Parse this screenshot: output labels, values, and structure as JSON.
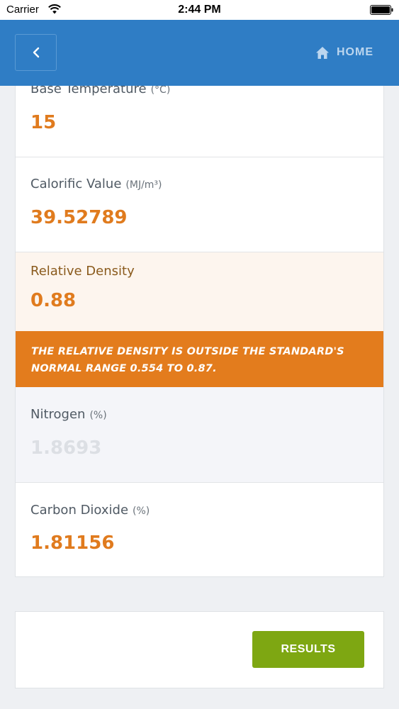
{
  "status_bar": {
    "carrier": "Carrier",
    "time": "2:44 PM"
  },
  "header": {
    "home_label": "HOME",
    "color": "#2f7dc5"
  },
  "fields": [
    {
      "label": "Base Temperature",
      "unit": "(°C)",
      "value": "15"
    },
    {
      "label": "Calorific Value",
      "unit": "(MJ/m³)",
      "value": "39.52789"
    },
    {
      "label": "Relative Density",
      "unit": "",
      "value": "0.88"
    },
    {
      "label": "Nitrogen",
      "unit": "(%)",
      "value": "1.8693"
    },
    {
      "label": "Carbon Dioxide",
      "unit": "(%)",
      "value": "1.81156"
    }
  ],
  "warning": {
    "text": "THE RELATIVE DENSITY IS OUTSIDE THE STANDARD'S NORMAL RANGE 0.554 TO 0.87."
  },
  "results": {
    "label": "RESULTS"
  },
  "colors": {
    "accent": "#e07b1e",
    "warning": "#e37c1d",
    "results": "#7ea712"
  }
}
